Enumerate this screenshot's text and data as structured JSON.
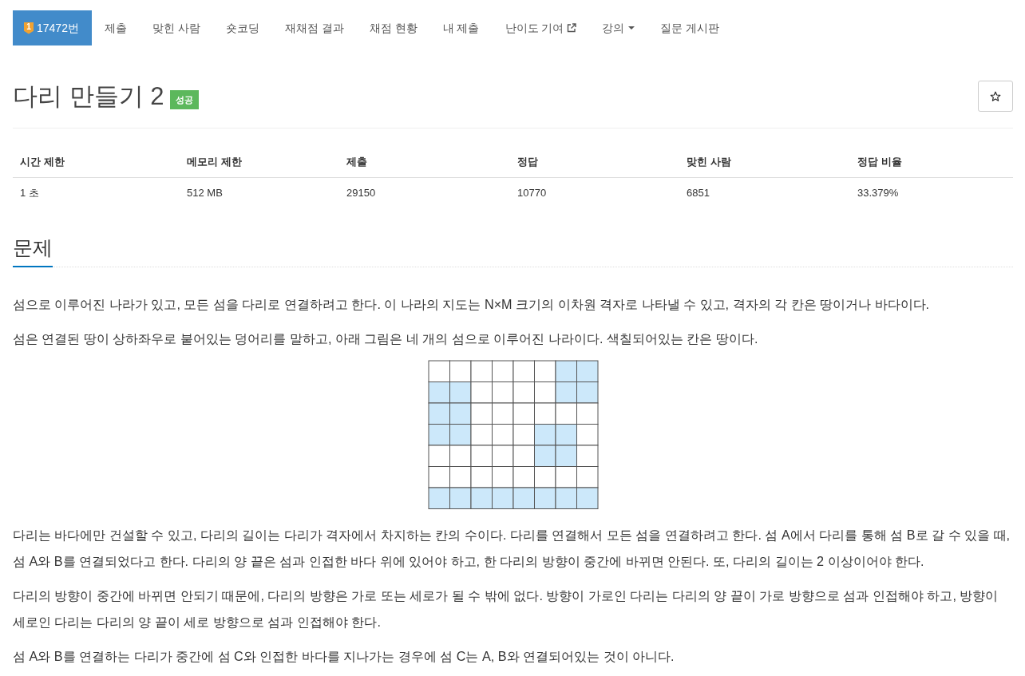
{
  "nav": {
    "tabs": [
      {
        "label": "17472번",
        "badge": "1",
        "kind": "problem",
        "selected": true
      },
      {
        "label": "제출",
        "kind": "plain",
        "selected": false
      },
      {
        "label": "맞힌 사람",
        "kind": "plain",
        "selected": false
      },
      {
        "label": "숏코딩",
        "kind": "plain",
        "selected": false
      },
      {
        "label": "재채점 결과",
        "kind": "plain",
        "selected": false
      },
      {
        "label": "채점 현황",
        "kind": "plain",
        "selected": false
      },
      {
        "label": "내 제출",
        "kind": "plain",
        "selected": false
      },
      {
        "label": "난이도 기여",
        "kind": "external",
        "selected": false
      },
      {
        "label": "강의",
        "kind": "dropdown",
        "selected": false
      },
      {
        "label": "질문 게시판",
        "kind": "plain",
        "selected": false
      }
    ]
  },
  "problem": {
    "title": "다리 만들기 2",
    "status_badge": "성공"
  },
  "limits_table": {
    "columns": [
      "시간 제한",
      "메모리 제한",
      "제출",
      "정답",
      "맞힌 사람",
      "정답 비율"
    ],
    "rows": [
      [
        "1 초",
        "512 MB",
        "29150",
        "10770",
        "6851",
        "33.379%"
      ]
    ]
  },
  "statement": {
    "heading": "문제",
    "blocks": [
      {
        "kind": "text",
        "text": "섬으로 이루어진 나라가 있고, 모든 섬을 다리로 연결하려고 한다. 이 나라의 지도는 N×M 크기의 이차원 격자로 나타낼 수 있고, 격자의 각 칸은 땅이거나 바다이다."
      },
      {
        "kind": "text",
        "text": "섬은 연결된 땅이 상하좌우로 붙어있는 덩어리를 말하고, 아래 그림은 네 개의 섬으로 이루어진 나라이다. 색칠되어있는 칸은 땅이다."
      },
      {
        "kind": "grid",
        "land": [
          [
            false,
            false,
            false,
            false,
            false,
            false,
            true,
            true
          ],
          [
            true,
            true,
            false,
            false,
            false,
            false,
            true,
            true
          ],
          [
            true,
            true,
            false,
            false,
            false,
            false,
            false,
            false
          ],
          [
            true,
            true,
            false,
            false,
            false,
            true,
            true,
            false
          ],
          [
            false,
            false,
            false,
            false,
            false,
            true,
            true,
            false
          ],
          [
            false,
            false,
            false,
            false,
            false,
            false,
            false,
            false
          ],
          [
            true,
            true,
            true,
            true,
            true,
            true,
            true,
            true
          ]
        ]
      },
      {
        "kind": "text",
        "text": "다리는 바다에만 건설할 수 있고, 다리의 길이는 다리가 격자에서 차지하는 칸의 수이다. 다리를 연결해서 모든 섬을 연결하려고 한다. 섬 A에서 다리를 통해 섬 B로 갈 수 있을 때, 섬 A와 B를 연결되었다고 한다. 다리의 양 끝은 섬과 인접한 바다 위에 있어야 하고, 한 다리의 방향이 중간에 바뀌면 안된다. 또, 다리의 길이는 2 이상이어야 한다."
      },
      {
        "kind": "text",
        "text": "다리의 방향이 중간에 바뀌면 안되기 때문에, 다리의 방향은 가로 또는 세로가 될 수 밖에 없다. 방향이 가로인 다리는 다리의 양 끝이 가로 방향으로 섬과 인접해야 하고, 방향이 세로인 다리는 다리의 양 끝이 세로 방향으로 섬과 인접해야 한다."
      },
      {
        "kind": "text",
        "text": "섬 A와 B를 연결하는 다리가 중간에 섬 C와 인접한 바다를 지나가는 경우에 섬 C는 A, B와 연결되어있는 것이 아니다."
      }
    ]
  }
}
